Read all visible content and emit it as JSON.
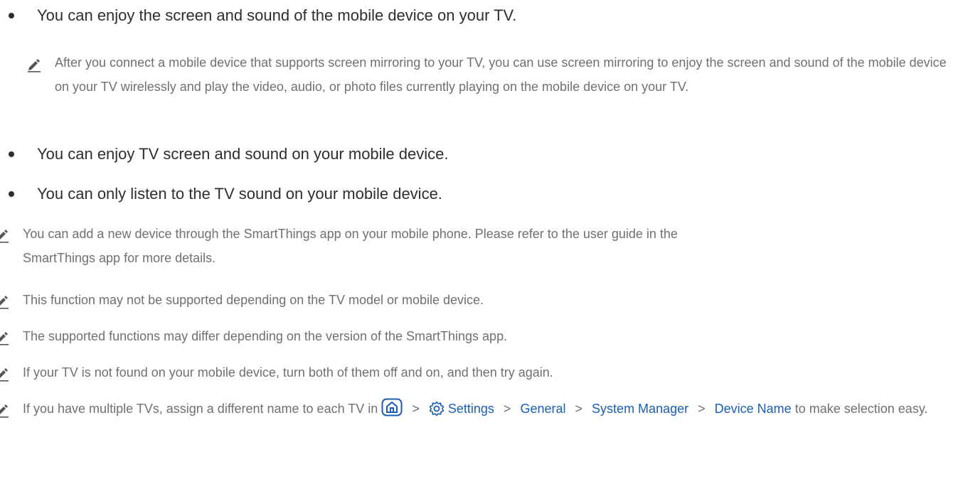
{
  "bullets": [
    "You can enjoy the screen and sound of the mobile device on your TV.",
    "You can enjoy TV screen and sound on your mobile device.",
    "You can only listen to the TV sound on your mobile device."
  ],
  "sub_note": "After you connect a mobile device that supports screen mirroring to your TV, you can use screen mirroring to enjoy the screen and sound of the mobile device on your TV wirelessly and play the video, audio, or photo files currently playing on the mobile device on your TV.",
  "notes": [
    "You can add a new device through the SmartThings app on your mobile phone. Please refer to the user guide in the SmartThings app for more details.",
    "This function may not be supported depending on the TV model or mobile device.",
    "The supported functions may differ depending on the version of the SmartThings app.",
    "If your TV is not found on your mobile device, turn both of them off and on, and then try again."
  ],
  "last_note": {
    "prefix": "If you have multiple TVs, assign a different name to each TV in",
    "path": [
      "Settings",
      "General",
      "System Manager",
      "Device Name"
    ],
    "suffix": "to make selection easy.",
    "separator": ">",
    "icons": [
      "home-icon",
      "settings-gear-icon"
    ]
  },
  "colors": {
    "link": "#1a5fb4",
    "note_text": "#707070",
    "bullet_text": "#2e2e2e"
  }
}
